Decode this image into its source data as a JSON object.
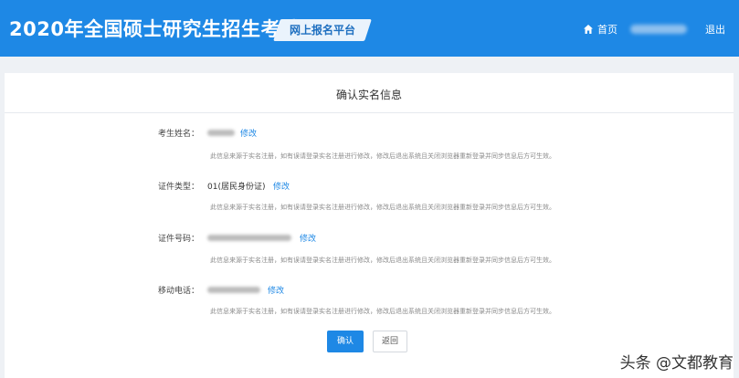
{
  "header": {
    "site_title": "2020年全国硕士研究生招生考试",
    "platform_badge": "网上报名平台",
    "home_label": "首页",
    "logout_label": "退出",
    "accent_color": "#1e88e5"
  },
  "card": {
    "title": "确认实名信息",
    "edit_label": "修改",
    "hint_text": "此信息来源于实名注册，如有误请登录实名注册进行修改，修改后退出系统且关闭浏览器重新登录并同步信息后方可生效。",
    "fields": [
      {
        "label": "考生姓名：",
        "value": ""
      },
      {
        "label": "证件类型：",
        "value": "01(居民身份证)"
      },
      {
        "label": "证件号码：",
        "value": ""
      },
      {
        "label": "移动电话：",
        "value": ""
      }
    ]
  },
  "buttons": {
    "confirm": "确认",
    "back": "返回"
  },
  "watermark": "头条 @文都教育"
}
